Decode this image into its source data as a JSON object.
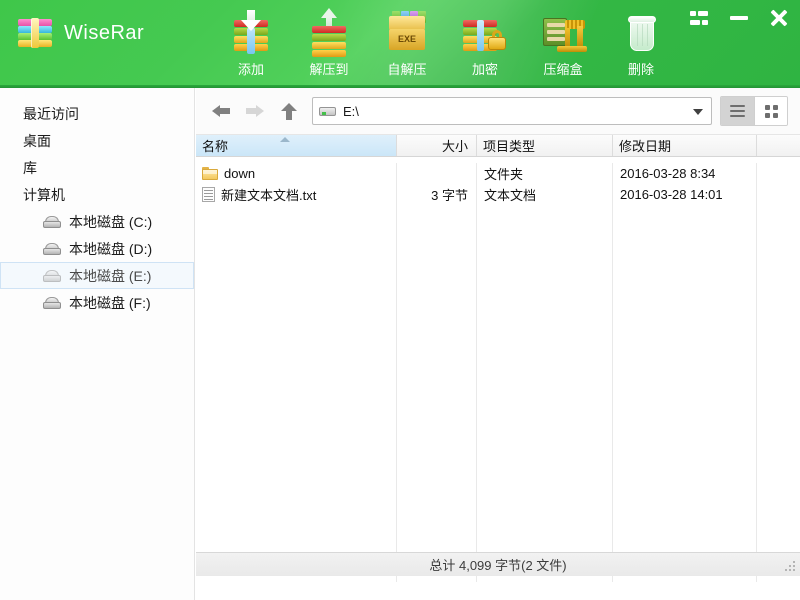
{
  "app": {
    "title": "WiseRar",
    "logo_icon": "archive-logo-icon",
    "accent": "#3fc74a"
  },
  "toolbar": {
    "buttons": [
      {
        "label": "添加",
        "icon": "add-to-archive-icon"
      },
      {
        "label": "解压到",
        "icon": "extract-to-icon"
      },
      {
        "label": "自解压",
        "icon": "sfx-exe-icon",
        "badge": "EXE"
      },
      {
        "label": "加密",
        "icon": "encrypt-lock-icon"
      },
      {
        "label": "压缩盒",
        "icon": "compress-box-icon"
      },
      {
        "label": "删除",
        "icon": "delete-trash-icon"
      }
    ]
  },
  "window_controls": {
    "menu_label": "菜单",
    "minimize_label": "最小化",
    "close_label": "关闭"
  },
  "sidebar": {
    "items": [
      {
        "label": "最近访问",
        "level": 0,
        "selected": false,
        "icon": ""
      },
      {
        "label": "桌面",
        "level": 0,
        "selected": false,
        "icon": ""
      },
      {
        "label": "库",
        "level": 0,
        "selected": false,
        "icon": ""
      },
      {
        "label": "计算机",
        "level": 0,
        "selected": false,
        "icon": ""
      },
      {
        "label": "本地磁盘 (C:)",
        "level": 1,
        "selected": false,
        "icon": "drive-icon"
      },
      {
        "label": "本地磁盘 (D:)",
        "level": 1,
        "selected": false,
        "icon": "drive-icon"
      },
      {
        "label": "本地磁盘 (E:)",
        "level": 1,
        "selected": true,
        "icon": "drive-icon"
      },
      {
        "label": "本地磁盘 (F:)",
        "level": 1,
        "selected": false,
        "icon": "drive-icon"
      }
    ]
  },
  "addressbar": {
    "back_icon": "arrow-back-icon",
    "forward_icon": "arrow-forward-icon",
    "up_icon": "arrow-up-icon",
    "path_icon": "drive-icon",
    "path_value": "E:\\",
    "path_placeholder": "",
    "dropdown_icon": "chevron-down-icon",
    "view_list_icon": "list-view-icon",
    "view_grid_icon": "grid-view-icon",
    "view_active": "list"
  },
  "filelist": {
    "columns": [
      {
        "key": "name",
        "label": "名称",
        "sorted": true,
        "sort_dir": "asc",
        "align": "left"
      },
      {
        "key": "size",
        "label": "大小",
        "sorted": false,
        "align": "right"
      },
      {
        "key": "type",
        "label": "项目类型",
        "sorted": false,
        "align": "left"
      },
      {
        "key": "date",
        "label": "修改日期",
        "sorted": false,
        "align": "left"
      },
      {
        "key": "extra",
        "label": "",
        "sorted": false,
        "align": "left"
      }
    ],
    "rows": [
      {
        "icon": "folder-icon",
        "name": "down",
        "size": "",
        "type": "文件夹",
        "date": "2016-03-28 8:34"
      },
      {
        "icon": "document-icon",
        "name": "新建文本文档.txt",
        "size": "3 字节",
        "type": "文本文档",
        "date": "2016-03-28 14:01"
      }
    ]
  },
  "statusbar": {
    "text": "总计  4,099 字节(2 文件)",
    "grip_icon": "resize-grip-icon"
  }
}
